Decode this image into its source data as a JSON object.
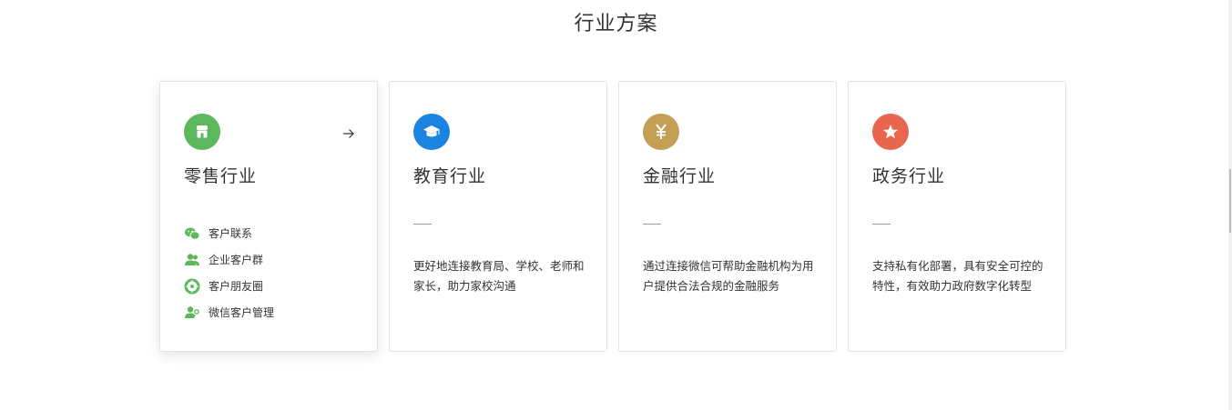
{
  "section": {
    "title": "行业方案"
  },
  "cards": [
    {
      "title": "零售行业",
      "icon": "store-icon",
      "color": "#5cb85c",
      "features": [
        {
          "icon": "wechat-icon",
          "label": "客户联系"
        },
        {
          "icon": "users-icon",
          "label": "企业客户群"
        },
        {
          "icon": "moments-icon",
          "label": "客户朋友圈"
        },
        {
          "icon": "user-manage-icon",
          "label": "微信客户管理"
        }
      ]
    },
    {
      "title": "教育行业",
      "icon": "graduation-cap-icon",
      "color": "#1a84e0",
      "description": "更好地连接教育局、学校、老师和家长，助力家校沟通"
    },
    {
      "title": "金融行业",
      "icon": "yuan-icon",
      "color": "#c39f54",
      "description": "通过连接微信可帮助金融机构为用户提供合法合规的金融服务"
    },
    {
      "title": "政务行业",
      "icon": "star-icon",
      "color": "#e8664d",
      "description": "支持私有化部署，具有安全可控的特性，有效助力政府数字化转型"
    }
  ]
}
